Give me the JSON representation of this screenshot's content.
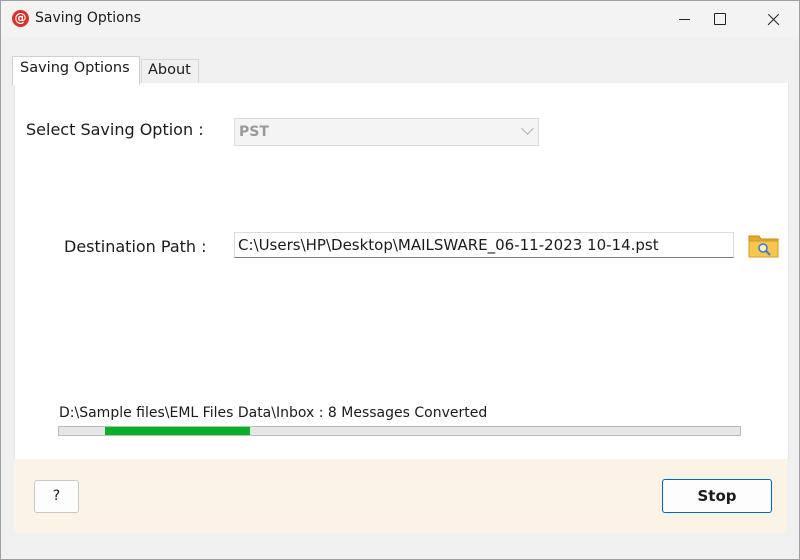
{
  "window": {
    "title": "Saving Options",
    "app_icon_glyph": "@",
    "accent_color": "#0067c0"
  },
  "tabs": [
    {
      "label": "Saving Options",
      "selected": true
    },
    {
      "label": "About",
      "selected": false
    }
  ],
  "form": {
    "saving_option_label": "Select Saving Option :",
    "saving_option_value": "PST",
    "destination_label": "Destination Path :",
    "destination_value": "C:\\Users\\HP\\Desktop\\MAILSWARE_06-11-2023 10-14.pst",
    "browse_icon": "folder-search-icon"
  },
  "progress": {
    "status_text": "D:\\Sample files\\EML Files Data\\Inbox : 8 Messages Converted",
    "fill_start": 0.068,
    "fill_end": 0.28,
    "fill_color": "#06b025"
  },
  "footer": {
    "help_label": "?",
    "stop_label": "Stop"
  }
}
